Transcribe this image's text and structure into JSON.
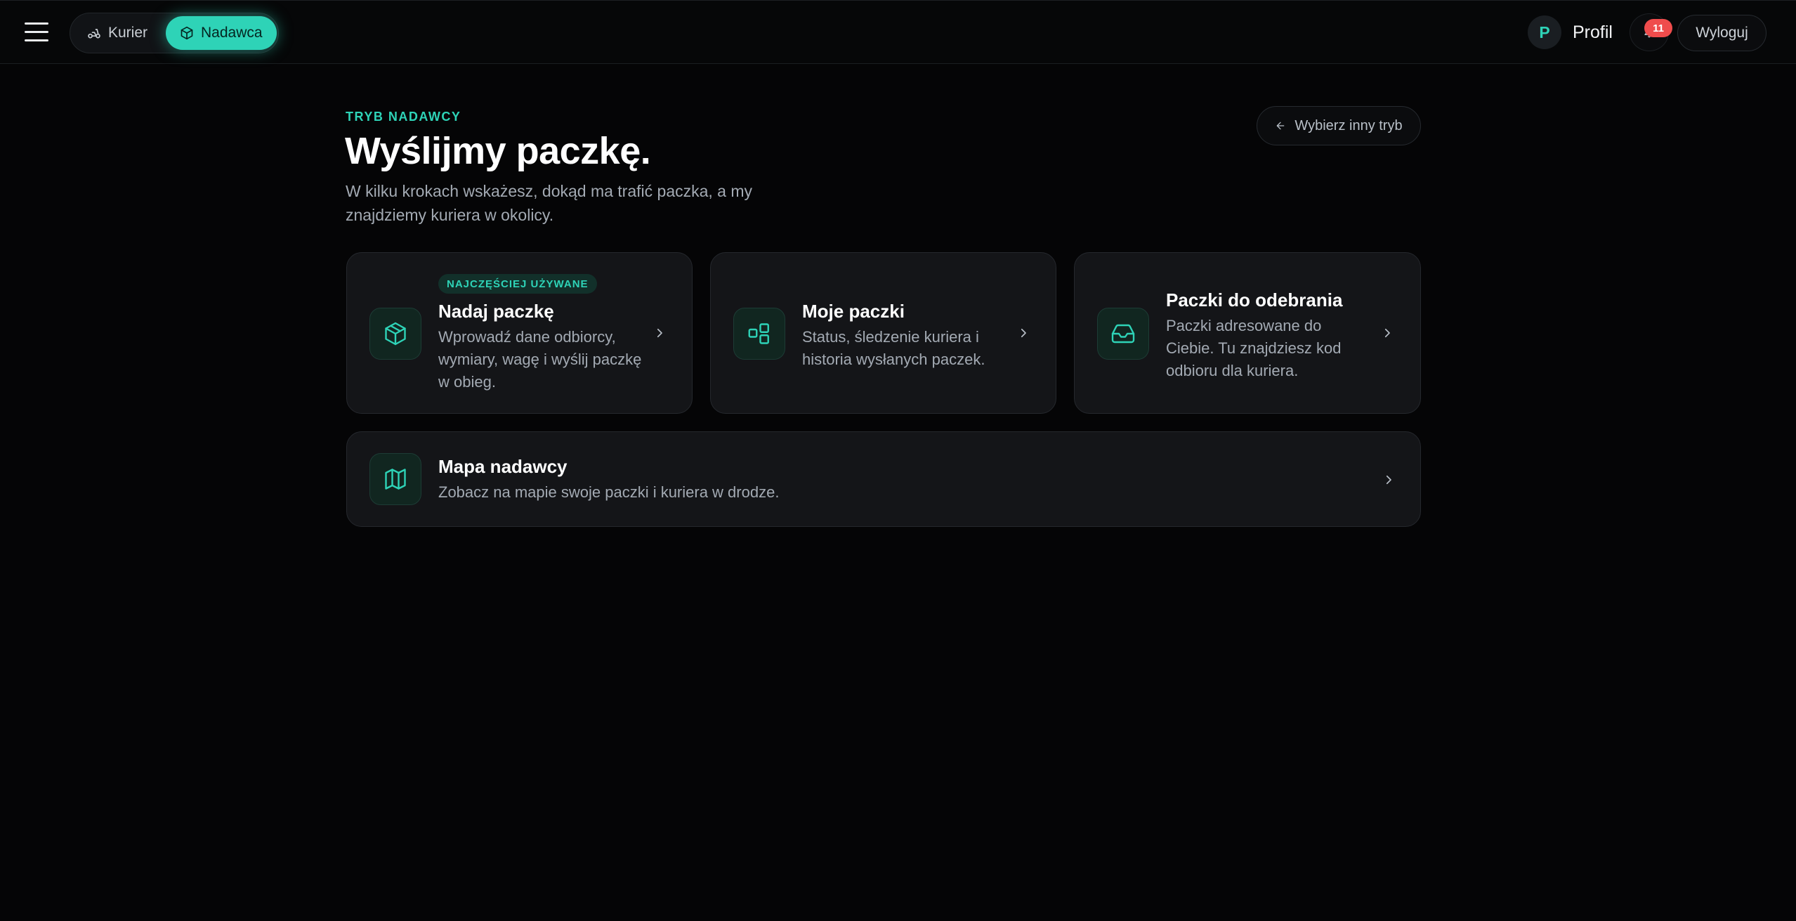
{
  "header": {
    "modes": {
      "kurier_label": "Kurier",
      "nadawca_label": "Nadawca"
    },
    "profile": {
      "avatar_letter": "P",
      "label": "Profil"
    },
    "notifications": {
      "count": "11"
    },
    "logout_label": "Wyloguj"
  },
  "main": {
    "eyebrow": "TRYB NADAWCY",
    "title": "Wyślijmy paczkę.",
    "subtitle": "W kilku krokach wskażesz, dokąd ma trafić paczka, a my znajdziemy kuriera w okolicy.",
    "back_label": "Wybierz inny tryb",
    "cards": [
      {
        "badge": "NAJCZĘŚCIEJ UŻYWANE",
        "title": "Nadaj paczkę",
        "description": "Wprowadź dane odbiorcy, wymiary, wagę i wyślij paczkę w obieg.",
        "icon": "package-icon"
      },
      {
        "title": "Moje paczki",
        "description": "Status, śledzenie kuriera i historia wysłanych paczek.",
        "icon": "boxes-icon"
      },
      {
        "title": "Paczki do odebrania",
        "description": "Paczki adresowane do Ciebie. Tu znajdziesz kod odbioru dla kuriera.",
        "icon": "inbox-icon"
      }
    ],
    "map_card": {
      "title": "Mapa nadawcy",
      "description": "Zobacz na mapie swoje paczki i kuriera w drodze.",
      "icon": "map-icon"
    }
  },
  "colors": {
    "accent": "#2ed3b7",
    "background": "#050506",
    "card": "#141518",
    "badge": "#ef4c4c"
  }
}
